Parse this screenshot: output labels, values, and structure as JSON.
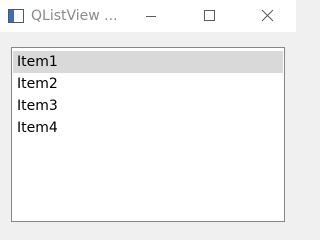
{
  "window": {
    "title": "QListView ...",
    "icon": "window-app-icon",
    "controls": {
      "minimize_icon": "minimize-icon",
      "maximize_icon": "maximize-icon",
      "close_icon": "close-icon"
    }
  },
  "list": {
    "items": [
      {
        "label": "Item1",
        "selected": true
      },
      {
        "label": "Item2",
        "selected": false
      },
      {
        "label": "Item3",
        "selected": false
      },
      {
        "label": "Item4",
        "selected": false
      }
    ]
  },
  "colors": {
    "titlebar_bg": "#ffffff",
    "client_bg": "#f0f0f0",
    "list_bg": "#ffffff",
    "list_border": "#828790",
    "selection_bg": "#d9d9d9",
    "title_text": "#8a8a8a"
  }
}
